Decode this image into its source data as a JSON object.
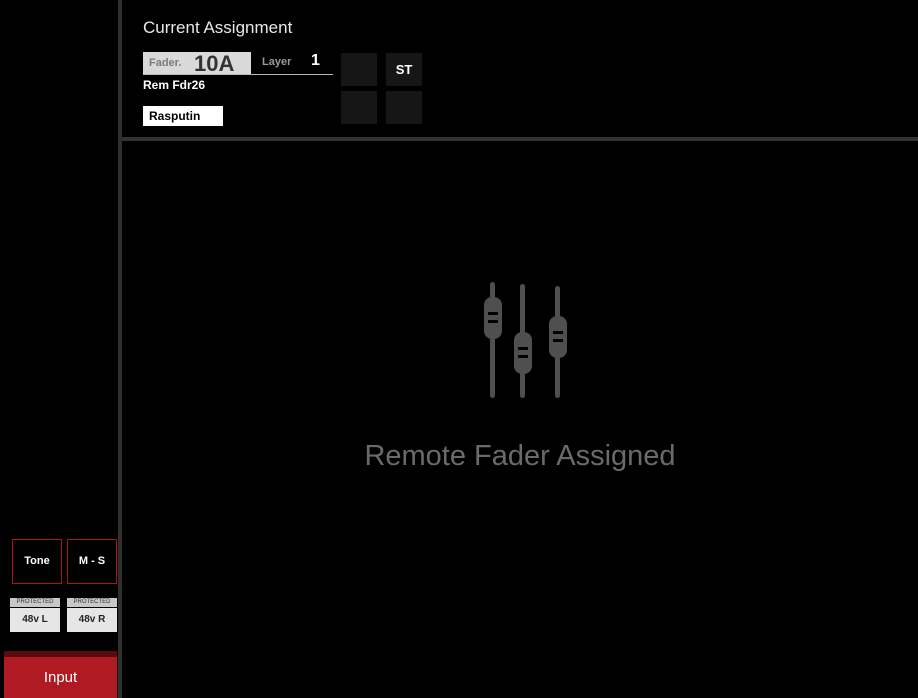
{
  "assignment": {
    "title": "Current Assignment",
    "fader_label": "Fader.",
    "fader_number": "10A",
    "layer_label": "Layer",
    "layer_number": "1",
    "remote_label": "Rem Fdr26",
    "channel_name": "Rasputin",
    "st_label": "ST"
  },
  "main": {
    "icon": "faders-icon",
    "message": "Remote Fader Assigned"
  },
  "sidebar": {
    "tone_label": "Tone",
    "ms_label": "M - S",
    "protected_left": "PROTECTED",
    "protected_right": "PROTECTED",
    "phantom_left": "48v L",
    "phantom_right": "48v R",
    "input_label": "Input"
  },
  "colors": {
    "background": "#000000",
    "accent_red": "#b01a22",
    "message_gray": "#6a6a6a"
  }
}
